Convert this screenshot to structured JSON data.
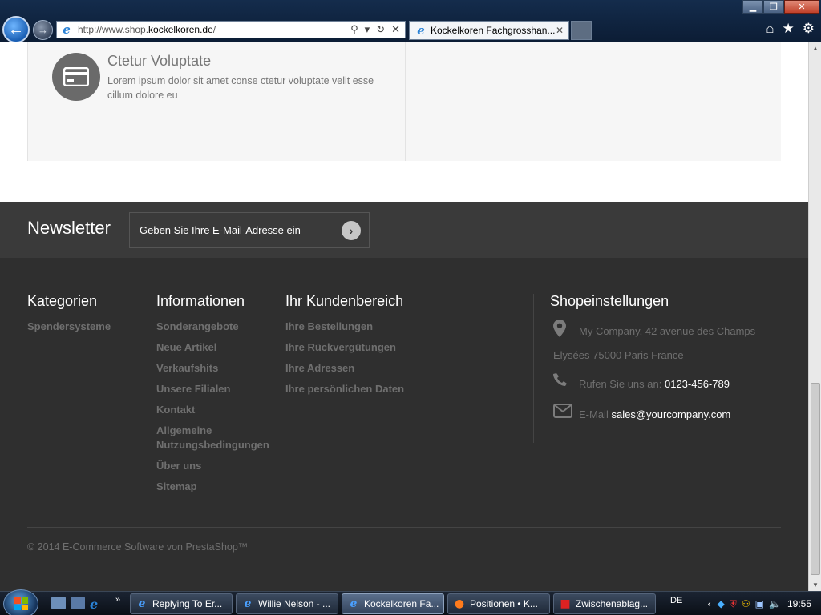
{
  "browser": {
    "url_prefix": "http://www.shop.",
    "url_domain": "kockelkoren.de",
    "url_suffix": "/",
    "tab_title": "Kockelkoren Fachgrosshan..."
  },
  "feature": {
    "title": "Ctetur Voluptate",
    "text": "Lorem ipsum dolor sit amet conse ctetur voluptate velit esse cillum dolore eu"
  },
  "newsletter": {
    "title": "Newsletter",
    "placeholder": "Geben Sie Ihre E-Mail-Adresse ein"
  },
  "footer": {
    "kategorien": {
      "title": "Kategorien",
      "items": [
        "Spendersysteme"
      ]
    },
    "informationen": {
      "title": "Informationen",
      "items": [
        "Sonderangebote",
        "Neue Artikel",
        "Verkaufshits",
        "Unsere Filialen",
        "Kontakt",
        "Allgemeine Nutzungsbedingungen",
        "Über uns",
        "Sitemap"
      ]
    },
    "kundenbereich": {
      "title": "Ihr Kundenbereich",
      "items": [
        "Ihre Bestellungen",
        "Ihre Rückvergütungen",
        "Ihre Adressen",
        "Ihre persönlichen Daten"
      ]
    },
    "shop": {
      "title": "Shopeinstellungen",
      "address_line1": "My Company, 42 avenue des Champs",
      "address_line2": "Elysées 75000 Paris France",
      "phone_label": "Rufen Sie uns an:",
      "phone": "0123-456-789",
      "email_label": "E-Mail",
      "email": "sales@yourcompany.com"
    },
    "copyright": "© 2014 E-Commerce Software von PrestaShop™"
  },
  "taskbar": {
    "windows": [
      "Replying To Er...",
      "Willie Nelson - ...",
      "Kockelkoren Fa...",
      "Positionen • K...",
      "Zwischenablag..."
    ],
    "language": "DE",
    "time": "19:55"
  },
  "colors": {
    "footer_bg": "#2f2f2f",
    "newsletter_bg": "#3a3a3a",
    "muted_text": "#6f6f6f",
    "link_accent": "#2a82d6"
  }
}
